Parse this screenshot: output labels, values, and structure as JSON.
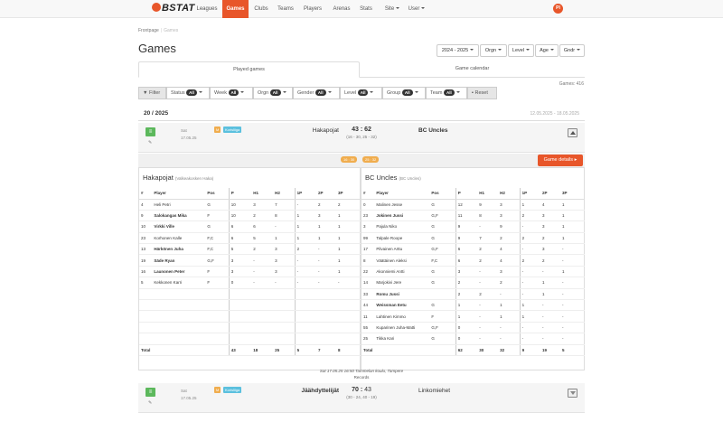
{
  "nav": {
    "logo": "BSTAT",
    "items": [
      {
        "label": "Leagues",
        "active": false
      },
      {
        "label": "Games",
        "active": true
      },
      {
        "label": "Clubs",
        "active": false
      },
      {
        "label": "Teams",
        "active": false
      },
      {
        "label": "Players",
        "active": false
      },
      {
        "label": "Arenas",
        "active": false
      },
      {
        "label": "Stats",
        "active": false
      }
    ],
    "site": "Site",
    "user": "User",
    "avatar": "PI"
  },
  "breadcrumb": {
    "home": "Frontpage",
    "sep": "|",
    "current": "Games"
  },
  "title": "Games",
  "dropdowns": [
    "2024 - 2025",
    "Orgn",
    "Level",
    "Age",
    "Gndr"
  ],
  "tabs": [
    "Played games",
    "Game calendar"
  ],
  "games_count": "Games: 416",
  "filters": {
    "filter": "Filter",
    "items": [
      {
        "label": "Status",
        "value": "All"
      },
      {
        "label": "Week",
        "value": "All"
      },
      {
        "label": "Orgn",
        "value": "All"
      },
      {
        "label": "Gender",
        "value": "All"
      },
      {
        "label": "Level",
        "value": "All"
      },
      {
        "label": "Group",
        "value": "All"
      },
      {
        "label": "Team",
        "value": "All"
      }
    ],
    "reset": "Reset"
  },
  "round": {
    "title": "20 / 2025",
    "dates": "12.05.2025 - 18.05.2025"
  },
  "game1": {
    "day": "Sat",
    "date": "17.05.25",
    "badge_m": "M",
    "badge_k": "Korisliiga",
    "home": "Hakapojat",
    "home_score": "43",
    "away_score": "62",
    "periods": "(16 - 30, 25 - 32)",
    "away": "BC Uncles",
    "q1": "16 : 30",
    "q2": "25 : 32",
    "details": "Game details",
    "venue": "Sat 17.05.25 16:50 Tammelan koulu, Tampere",
    "records": "Records"
  },
  "home_team": {
    "name": "Hakapojat",
    "sub": "(Valkeakosken Haka)",
    "headers": [
      "#",
      "Player",
      "Pos",
      "P",
      "H1",
      "H2",
      "1P",
      "2P",
      "3P"
    ],
    "rows": [
      [
        "4",
        "Heli Petri",
        "G",
        "10",
        "3",
        "7",
        "-",
        "2",
        "2"
      ],
      [
        "9",
        "Salokangas Mika",
        "F",
        "10",
        "2",
        "8",
        "1",
        "3",
        "1"
      ],
      [
        "10",
        "Virkki Ville",
        "G",
        "6",
        "6",
        "-",
        "1",
        "1",
        "1"
      ],
      [
        "23",
        "Korhonen Kalle",
        "F,C",
        "6",
        "5",
        "1",
        "1",
        "1",
        "1"
      ],
      [
        "13",
        "Härkönen Juha",
        "F,C",
        "5",
        "2",
        "3",
        "2",
        "-",
        "1"
      ],
      [
        "19",
        "Säde Ryan",
        "G,F",
        "3",
        "-",
        "3",
        "-",
        "-",
        "1"
      ],
      [
        "16",
        "Launonen Peter",
        "F",
        "3",
        "-",
        "3",
        "-",
        "-",
        "1"
      ],
      [
        "5",
        "Kekkonen Karri",
        "F",
        "0",
        "-",
        "-",
        "-",
        "-",
        "-"
      ]
    ],
    "bold_rows": [
      1,
      2,
      4,
      5,
      6
    ],
    "total": [
      "Total",
      "43",
      "18",
      "25",
      "5",
      "7",
      "8"
    ]
  },
  "away_team": {
    "name": "BC Uncles",
    "sub": "(BC Uncles)",
    "headers": [
      "#",
      "Player",
      "Pos",
      "P",
      "H1",
      "H2",
      "1P",
      "2P",
      "3P"
    ],
    "rows": [
      [
        "0",
        "Malinen Jesse",
        "G",
        "12",
        "9",
        "3",
        "1",
        "4",
        "1"
      ],
      [
        "23",
        "Jokinen Jussi",
        "G,F",
        "11",
        "8",
        "3",
        "2",
        "3",
        "1"
      ],
      [
        "3",
        "Pajula Niko",
        "G",
        "9",
        "-",
        "9",
        "-",
        "3",
        "1"
      ],
      [
        "99",
        "Talpale Roope",
        "G",
        "9",
        "7",
        "2",
        "2",
        "2",
        "1"
      ],
      [
        "17",
        "Pilvainen Arttu",
        "G,F",
        "6",
        "2",
        "4",
        "-",
        "3",
        "-"
      ],
      [
        "8",
        "Väätäinen Aleksi",
        "F,C",
        "6",
        "2",
        "4",
        "2",
        "2",
        "-"
      ],
      [
        "22",
        "Akonniemi Antti",
        "G",
        "3",
        "-",
        "3",
        "-",
        "-",
        "1"
      ],
      [
        "14",
        "Marjokivi Jere",
        "G",
        "2",
        "-",
        "2",
        "-",
        "1",
        "-"
      ],
      [
        "33",
        "Romu Jussi",
        "",
        "2",
        "2",
        "-",
        "-",
        "1",
        "-"
      ],
      [
        "44",
        "Weissman Eetu",
        "G",
        "1",
        "-",
        "1",
        "1",
        "-",
        "-"
      ],
      [
        "11",
        "Lahtinen Kimmo",
        "F",
        "1",
        "-",
        "1",
        "1",
        "-",
        "-"
      ],
      [
        "55",
        "Kuparinen Juha-Matti",
        "G,F",
        "0",
        "-",
        "-",
        "-",
        "-",
        "-"
      ],
      [
        "25",
        "Tikka Kari",
        "G",
        "0",
        "-",
        "-",
        "-",
        "-",
        "-"
      ]
    ],
    "bold_rows": [
      1,
      8,
      9
    ],
    "total": [
      "Total",
      "62",
      "30",
      "32",
      "9",
      "19",
      "5"
    ]
  },
  "game2": {
    "day": "Sat",
    "date": "17.05.25",
    "badge_m": "M",
    "badge_k": "Korisliiga",
    "home": "Jäähdyttelijät",
    "home_score": "70",
    "away_score": "43",
    "periods": "(30 - 24, 40 - 19)",
    "away": "Linkomiehet"
  },
  "colors": {
    "accent": "#e8562a",
    "green": "#5cb85c",
    "badge_orange": "#f0ad4e",
    "badge_blue": "#5bc0de"
  }
}
